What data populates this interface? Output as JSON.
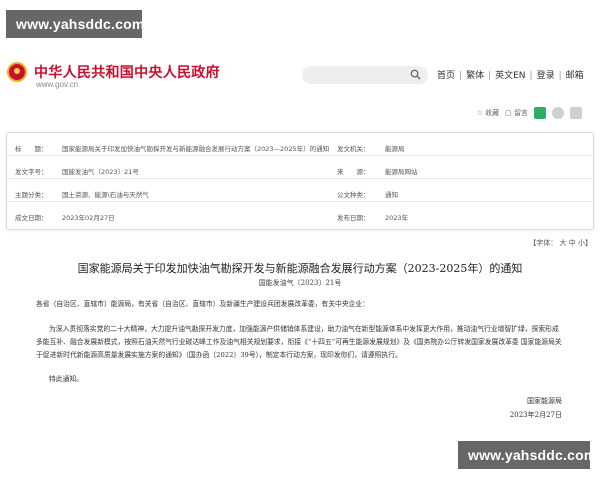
{
  "watermark": {
    "top": "www.yahsddc.com",
    "bottom": "www.yahsddc.com"
  },
  "header": {
    "site_title": "中华人民共和国中央人民政府",
    "site_url": "www.gov.cn",
    "search_placeholder": "",
    "nav": [
      "首页",
      "繁体",
      "英文EN",
      "登录",
      "邮箱"
    ]
  },
  "tools": {
    "favorite": "收藏",
    "print": "留言"
  },
  "meta": {
    "rows": [
      {
        "l1": "标　　题：",
        "v1": "国家能源局关于印发加快油气勘探开发与新能源融合发展行动方案（2023—2025年）的通知",
        "l2": "发文机关：",
        "v2": "能源局"
      },
      {
        "l1": "发文字号：",
        "v1": "国能发油气〔2023〕21号",
        "l2": "来　　源：",
        "v2": "能源局网站"
      },
      {
        "l1": "主题分类：",
        "v1": "国土资源、能源\\石油与天然气",
        "l2": "公文种类：",
        "v2": "通知"
      },
      {
        "l1": "成文日期：",
        "v1": "2023年02月27日",
        "l2": "发布日期：",
        "v2": "2023年"
      }
    ]
  },
  "fontsize": {
    "label": "【字体：",
    "big": "大",
    "mid": "中",
    "small": "小】"
  },
  "doc": {
    "title": "国家能源局关于印发加快油气勘探开发与新能源融合发展行动方案（2023-2025年）的通知",
    "number": "国能发油气〔2023〕21号",
    "addressee": "各省（自治区、直辖市）能源局，有关省（自治区、直辖市）及新疆生产建设兵团发展改革委，有关中央企业：",
    "main": "为深入贯彻落实党的二十大精神，大力提升油气勘探开发力度，加强能源产供储销体系建设，助力油气在新型能源体系中发挥更大作用，推动油气行业增智扩绿，探索形成多能互补、融合发展新模式，按照石油天然气行业碳达峰工作及油气相关规划要求，衔接《“十四五”可再生能源发展规划》及《国务院办公厅转发国家发展改革委 国家能源局关于促进新时代新能源高质量发展实施方案的通知》（国办函〔2022〕39号），制定本行动方案，现印发你们，请遵照执行。",
    "notice": "特此通知。",
    "sign_org": "国家能源局",
    "sign_date": "2023年2月27日"
  }
}
